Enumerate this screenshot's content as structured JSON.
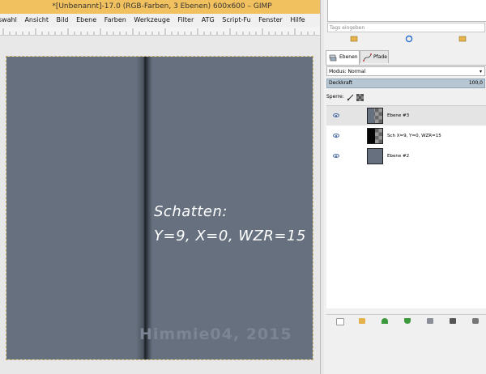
{
  "window": {
    "title": "*[Unbenannt]-17.0 (RGB-Farben, 3 Ebenen) 600x600 – GIMP"
  },
  "menu": [
    "swahl",
    "Ansicht",
    "Bild",
    "Ebene",
    "Farben",
    "Werkzeuge",
    "Filter",
    "ATG",
    "Script-Fu",
    "Fenster",
    "Hilfe"
  ],
  "canvas": {
    "background_color": "#66707f",
    "text_line1": "Schatten:",
    "text_line2": "Y=9, X=0, WZR=15",
    "watermark": "Himmie04, 2015"
  },
  "dock": {
    "tags_placeholder": "Tags eingeben",
    "tabs": [
      {
        "label": "Ebenen",
        "active": true
      },
      {
        "label": "Pfade",
        "active": false
      }
    ],
    "mode_label": "Modus: Normal",
    "opacity_label": "Deckkraft",
    "opacity_value": "100,0",
    "lock_label": "Sperre:",
    "layers": [
      {
        "name": "Ebene #3",
        "visible": true,
        "active": true,
        "thumb": "checker-dark"
      },
      {
        "name": "Sch X=9, Y=0, WZR=15",
        "visible": true,
        "active": false,
        "thumb": "black-shadow"
      },
      {
        "name": "Ebene #2",
        "visible": true,
        "active": false,
        "thumb": "solid-slate"
      }
    ],
    "bottom_icons": [
      "new-layer-icon",
      "new-group-icon",
      "raise-layer-icon",
      "lower-layer-icon",
      "duplicate-layer-icon",
      "anchor-layer-icon",
      "delete-layer-icon"
    ]
  },
  "colors": {
    "titlebar": "#f2c15f",
    "image": "#66707f",
    "selection": "#b6c6d2"
  }
}
